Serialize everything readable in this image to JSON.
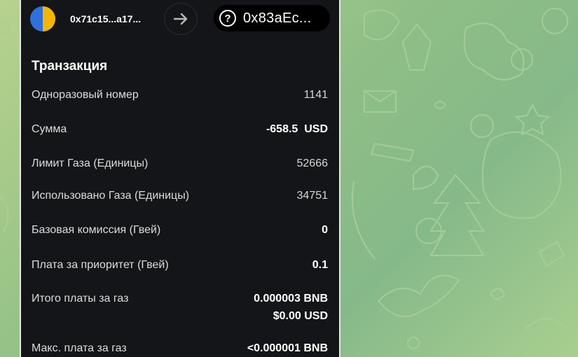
{
  "header": {
    "from_address": "0x71c15...a17...",
    "to_address": "0x83aEc..."
  },
  "section_title": "Транзакция",
  "rows": [
    {
      "label": "Одноразовый номер",
      "value": "1141"
    },
    {
      "label": "Сумма",
      "value": "-658.5",
      "unit": "USD"
    },
    {
      "label": "Лимит Газа (Единицы)",
      "value": "52666"
    },
    {
      "label": "Использовано Газа (Единицы)",
      "value": "34751"
    },
    {
      "label": "Базовая комиссия (Гвей)",
      "value": "0"
    },
    {
      "label": "Плата за приоритет (Гвей)",
      "value": "0.1"
    },
    {
      "label": "Итого платы за газ",
      "value": "0.000003 BNB",
      "value2": "$0.00 USD"
    },
    {
      "label": "Макс. плата за газ",
      "value": "<0.000001 BNB"
    }
  ],
  "icons": {
    "avatar": "account-avatar",
    "arrow": "arrow-right-icon",
    "question": "question-circle-icon"
  },
  "colors": {
    "panel_bg": "#141518",
    "pill_bg": "#000000",
    "avatar_yellow": "#f2b705",
    "avatar_blue": "#2f6fde",
    "wallpaper_green": "#8fbf86"
  }
}
